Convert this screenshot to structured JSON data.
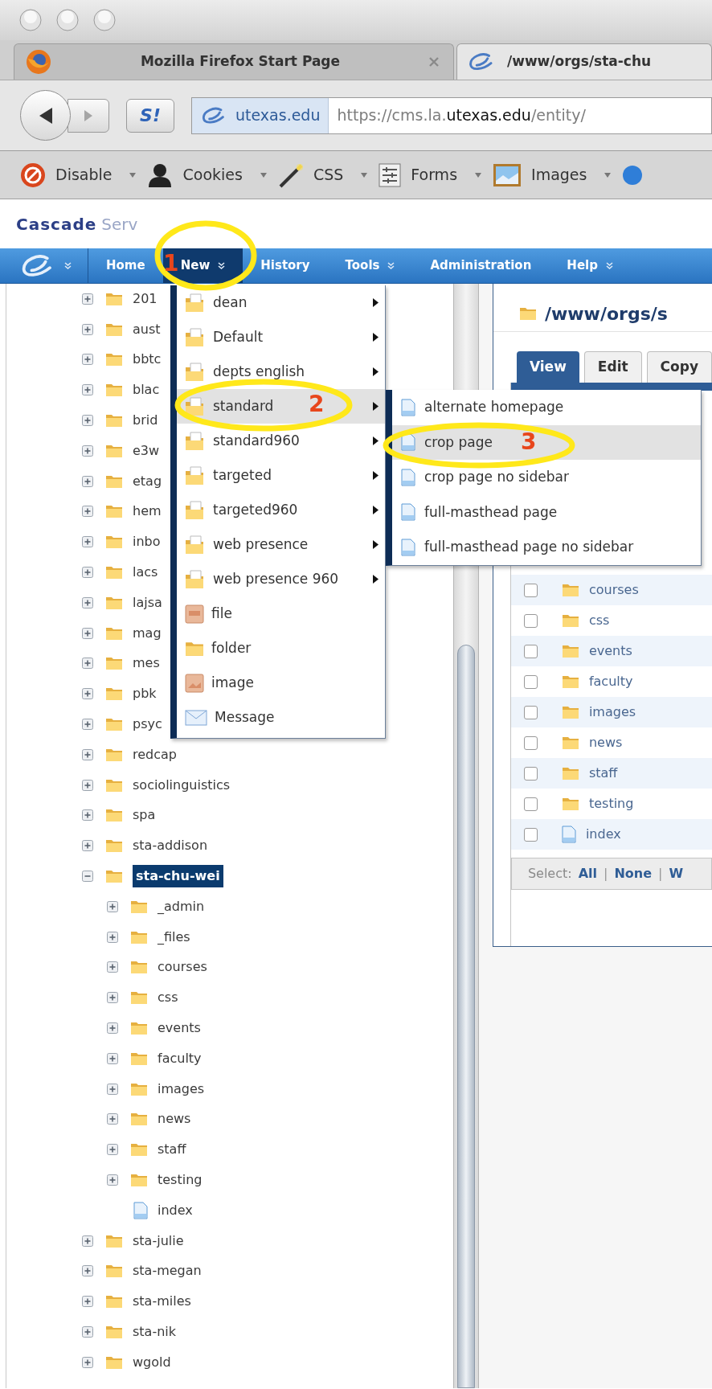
{
  "browser": {
    "tabs": [
      {
        "title": "Mozilla Firefox Start Page",
        "selected": false,
        "closable": true
      },
      {
        "title": "/www/orgs/sta-chu",
        "selected": true,
        "closable": false
      }
    ],
    "addon_button": "S!",
    "identity": "utexas.edu",
    "url": "https://cms.la.**utexas.edu**/entity/",
    "toolbar": [
      {
        "label": "Disable",
        "kind": "disable"
      },
      {
        "label": "Cookies",
        "kind": "cookies"
      },
      {
        "label": "CSS",
        "kind": "css"
      },
      {
        "label": "Forms",
        "kind": "forms"
      },
      {
        "label": "Images",
        "kind": "images"
      }
    ]
  },
  "app": {
    "logo": {
      "primary": "Cascade",
      "secondary": "Serv"
    },
    "nav": [
      {
        "label": "Home",
        "selected": false,
        "dropdown": false
      },
      {
        "label": "New",
        "selected": true,
        "dropdown": true
      },
      {
        "label": "History",
        "selected": false,
        "dropdown": false
      },
      {
        "label": "Tools",
        "selected": false,
        "dropdown": true
      },
      {
        "label": "Administration",
        "selected": false,
        "dropdown": false
      },
      {
        "label": "Help",
        "selected": false,
        "dropdown": true
      }
    ]
  },
  "tree": [
    {
      "label": "201",
      "kind": "folder",
      "expanded": false,
      "selected": false
    },
    {
      "label": "aust",
      "kind": "folder",
      "expanded": false,
      "selected": false
    },
    {
      "label": "bbtc",
      "kind": "folder",
      "expanded": false,
      "selected": false
    },
    {
      "label": "blac",
      "kind": "folder",
      "expanded": false,
      "selected": false
    },
    {
      "label": "brid",
      "kind": "folder",
      "expanded": false,
      "selected": false
    },
    {
      "label": "e3w",
      "kind": "folder",
      "expanded": false,
      "selected": false
    },
    {
      "label": "etag",
      "kind": "folder",
      "expanded": false,
      "selected": false
    },
    {
      "label": "hem",
      "kind": "folder",
      "expanded": false,
      "selected": false
    },
    {
      "label": "inbo",
      "kind": "folder",
      "expanded": false,
      "selected": false
    },
    {
      "label": "lacs",
      "kind": "folder",
      "expanded": false,
      "selected": false
    },
    {
      "label": "lajsa",
      "kind": "folder",
      "expanded": false,
      "selected": false
    },
    {
      "label": "mag",
      "kind": "folder",
      "expanded": false,
      "selected": false
    },
    {
      "label": "mes",
      "kind": "folder",
      "expanded": false,
      "selected": false
    },
    {
      "label": "pbk",
      "kind": "folder",
      "expanded": false,
      "selected": false
    },
    {
      "label": "psyc",
      "kind": "folder",
      "expanded": false,
      "selected": false
    },
    {
      "label": "redcap",
      "kind": "folder",
      "expanded": false,
      "selected": false
    },
    {
      "label": "sociolinguistics",
      "kind": "folder",
      "expanded": false,
      "selected": false
    },
    {
      "label": "spa",
      "kind": "folder",
      "expanded": false,
      "selected": false
    },
    {
      "label": "sta-addison",
      "kind": "folder",
      "expanded": false,
      "selected": false
    },
    {
      "label": "sta-chu-wei",
      "kind": "folder",
      "expanded": true,
      "selected": true,
      "children": [
        {
          "label": "_admin",
          "kind": "folder",
          "expanded": false,
          "selected": false
        },
        {
          "label": "_files",
          "kind": "folder",
          "expanded": false,
          "selected": false
        },
        {
          "label": "courses",
          "kind": "folder",
          "expanded": false,
          "selected": false
        },
        {
          "label": "css",
          "kind": "folder",
          "expanded": false,
          "selected": false
        },
        {
          "label": "events",
          "kind": "folder",
          "expanded": false,
          "selected": false
        },
        {
          "label": "faculty",
          "kind": "folder",
          "expanded": false,
          "selected": false
        },
        {
          "label": "images",
          "kind": "folder",
          "expanded": false,
          "selected": false
        },
        {
          "label": "news",
          "kind": "folder",
          "expanded": false,
          "selected": false
        },
        {
          "label": "staff",
          "kind": "folder",
          "expanded": false,
          "selected": false
        },
        {
          "label": "testing",
          "kind": "folder",
          "expanded": false,
          "selected": false
        },
        {
          "label": "index",
          "kind": "page",
          "selected": false
        }
      ]
    },
    {
      "label": "sta-julie",
      "kind": "folder",
      "expanded": false,
      "selected": false
    },
    {
      "label": "sta-megan",
      "kind": "folder",
      "expanded": false,
      "selected": false
    },
    {
      "label": "sta-miles",
      "kind": "folder",
      "expanded": false,
      "selected": false
    },
    {
      "label": "sta-nik",
      "kind": "folder",
      "expanded": false,
      "selected": false
    },
    {
      "label": "wgold",
      "kind": "folder",
      "expanded": false,
      "selected": false
    }
  ],
  "panel": {
    "path": "/www/orgs/s",
    "tabs": [
      {
        "label": "View",
        "selected": true
      },
      {
        "label": "Edit",
        "selected": false
      },
      {
        "label": "Copy",
        "selected": false
      }
    ],
    "rows": [
      {
        "name": "courses",
        "kind": "folder",
        "checked": false
      },
      {
        "name": "css",
        "kind": "folder",
        "checked": false
      },
      {
        "name": "events",
        "kind": "folder",
        "checked": false
      },
      {
        "name": "faculty",
        "kind": "folder",
        "checked": false
      },
      {
        "name": "images",
        "kind": "folder",
        "checked": false
      },
      {
        "name": "news",
        "kind": "folder",
        "checked": false
      },
      {
        "name": "staff",
        "kind": "folder",
        "checked": false
      },
      {
        "name": "testing",
        "kind": "folder",
        "checked": false
      },
      {
        "name": "index",
        "kind": "page",
        "checked": false
      }
    ],
    "select_bar": {
      "label": "Select:",
      "separator": "|",
      "links": [
        "All",
        "None",
        "W"
      ]
    }
  },
  "new_menu": {
    "items": [
      {
        "label": "dean",
        "kind": "template",
        "submenu": true,
        "selected": false
      },
      {
        "label": "Default",
        "kind": "template",
        "submenu": true,
        "selected": false
      },
      {
        "label": "depts english",
        "kind": "template",
        "submenu": true,
        "selected": false
      },
      {
        "label": "standard",
        "kind": "template",
        "submenu": true,
        "selected": true
      },
      {
        "label": "standard960",
        "kind": "template",
        "submenu": true,
        "selected": false
      },
      {
        "label": "targeted",
        "kind": "template",
        "submenu": true,
        "selected": false
      },
      {
        "label": "targeted960",
        "kind": "template",
        "submenu": true,
        "selected": false
      },
      {
        "label": "web presence",
        "kind": "template",
        "submenu": true,
        "selected": false
      },
      {
        "label": "web presence 960",
        "kind": "template",
        "submenu": true,
        "selected": false
      },
      {
        "label": "file",
        "kind": "file",
        "submenu": false,
        "selected": false
      },
      {
        "label": "folder",
        "kind": "folder",
        "submenu": false,
        "selected": false
      },
      {
        "label": "image",
        "kind": "image",
        "submenu": false,
        "selected": false
      },
      {
        "label": "Message",
        "kind": "message",
        "submenu": false,
        "selected": false
      }
    ]
  },
  "submenu": {
    "items": [
      {
        "label": "alternate homepage",
        "selected": false
      },
      {
        "label": "crop page",
        "selected": true
      },
      {
        "label": "crop page no sidebar",
        "selected": false
      },
      {
        "label": "full-masthead page",
        "selected": false
      },
      {
        "label": "full-masthead page no sidebar",
        "selected": false
      }
    ]
  },
  "annotations": [
    {
      "number": "1"
    },
    {
      "number": "2"
    },
    {
      "number": "3"
    }
  ]
}
